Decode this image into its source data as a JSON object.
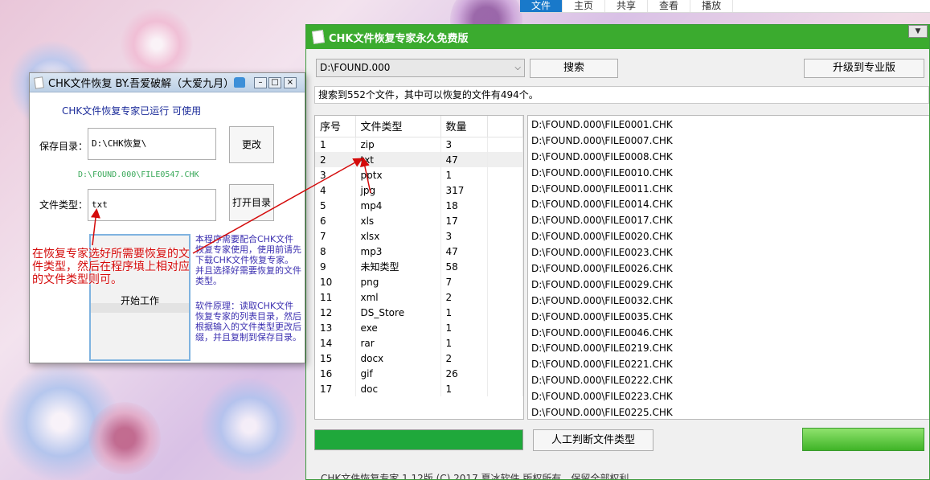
{
  "explorer_ribbon": {
    "tabs": [
      "文件",
      "主页",
      "共享",
      "查看",
      "播放"
    ]
  },
  "main_window": {
    "title": "CHK文件恢复专家永久免费版",
    "path_value": "D:\\FOUND.000",
    "search_label": "搜索",
    "upgrade_label": "升级到专业版",
    "status_text": "搜索到552个文件，其中可以恢复的文件有494个。",
    "table": {
      "headers": [
        "序号",
        "文件类型",
        "数量"
      ],
      "rows": [
        [
          "1",
          "zip",
          "3"
        ],
        [
          "2",
          "txt",
          "47"
        ],
        [
          "3",
          "pptx",
          "1"
        ],
        [
          "4",
          "jpg",
          "317"
        ],
        [
          "5",
          "mp4",
          "18"
        ],
        [
          "6",
          "xls",
          "17"
        ],
        [
          "7",
          "xlsx",
          "3"
        ],
        [
          "8",
          "mp3",
          "47"
        ],
        [
          "9",
          "未知类型",
          "58"
        ],
        [
          "10",
          "png",
          "7"
        ],
        [
          "11",
          "xml",
          "2"
        ],
        [
          "12",
          "DS_Store",
          "1"
        ],
        [
          "13",
          "exe",
          "1"
        ],
        [
          "14",
          "rar",
          "1"
        ],
        [
          "15",
          "docx",
          "2"
        ],
        [
          "16",
          "gif",
          "26"
        ],
        [
          "17",
          "doc",
          "1"
        ]
      ]
    },
    "files": [
      "D:\\FOUND.000\\FILE0001.CHK",
      "D:\\FOUND.000\\FILE0007.CHK",
      "D:\\FOUND.000\\FILE0008.CHK",
      "D:\\FOUND.000\\FILE0010.CHK",
      "D:\\FOUND.000\\FILE0011.CHK",
      "D:\\FOUND.000\\FILE0014.CHK",
      "D:\\FOUND.000\\FILE0017.CHK",
      "D:\\FOUND.000\\FILE0020.CHK",
      "D:\\FOUND.000\\FILE0023.CHK",
      "D:\\FOUND.000\\FILE0026.CHK",
      "D:\\FOUND.000\\FILE0029.CHK",
      "D:\\FOUND.000\\FILE0032.CHK",
      "D:\\FOUND.000\\FILE0035.CHK",
      "D:\\FOUND.000\\FILE0046.CHK",
      "D:\\FOUND.000\\FILE0219.CHK",
      "D:\\FOUND.000\\FILE0221.CHK",
      "D:\\FOUND.000\\FILE0222.CHK",
      "D:\\FOUND.000\\FILE0223.CHK",
      "D:\\FOUND.000\\FILE0225.CHK"
    ],
    "progress_percent": 100,
    "manual_label": "人工判断文件类型",
    "footer": "CHK文件恢复专家 1.12版 (C) 2017 夏冰软件 版权所有，保留全部权利"
  },
  "small_window": {
    "title": "CHK文件恢复 BY.吾爱破解（大爱九月）",
    "run_status": "CHK文件恢复专家已运行   可使用",
    "save_label": "保存目录：",
    "save_value": "D:\\CHK恢复\\",
    "change_label": "更改",
    "current_file": "D:\\FOUND.000\\FILE0547.CHK",
    "type_label": "文件类型：",
    "type_value": "txt",
    "open_label": "打开目录",
    "start_label": "开始工作",
    "info1": "本程序需要配合CHK文件恢复专家使用，使用前请先下载CHK文件恢复专家。并且选择好需要恢复的文件类型。",
    "info2": "软件原理：读取CHK文件恢复专家的列表目录，然后根据输入的文件类型更改后缀，并且复制到保存目录。"
  },
  "annotation": "在恢复专家选好所需要恢复的文件类型，然后在程序填上相对应的文件类型则可。",
  "colors": {
    "title_green": "#3bab2f",
    "annotation_red": "#d40b0b",
    "info_purple": "#3b2fb0"
  }
}
